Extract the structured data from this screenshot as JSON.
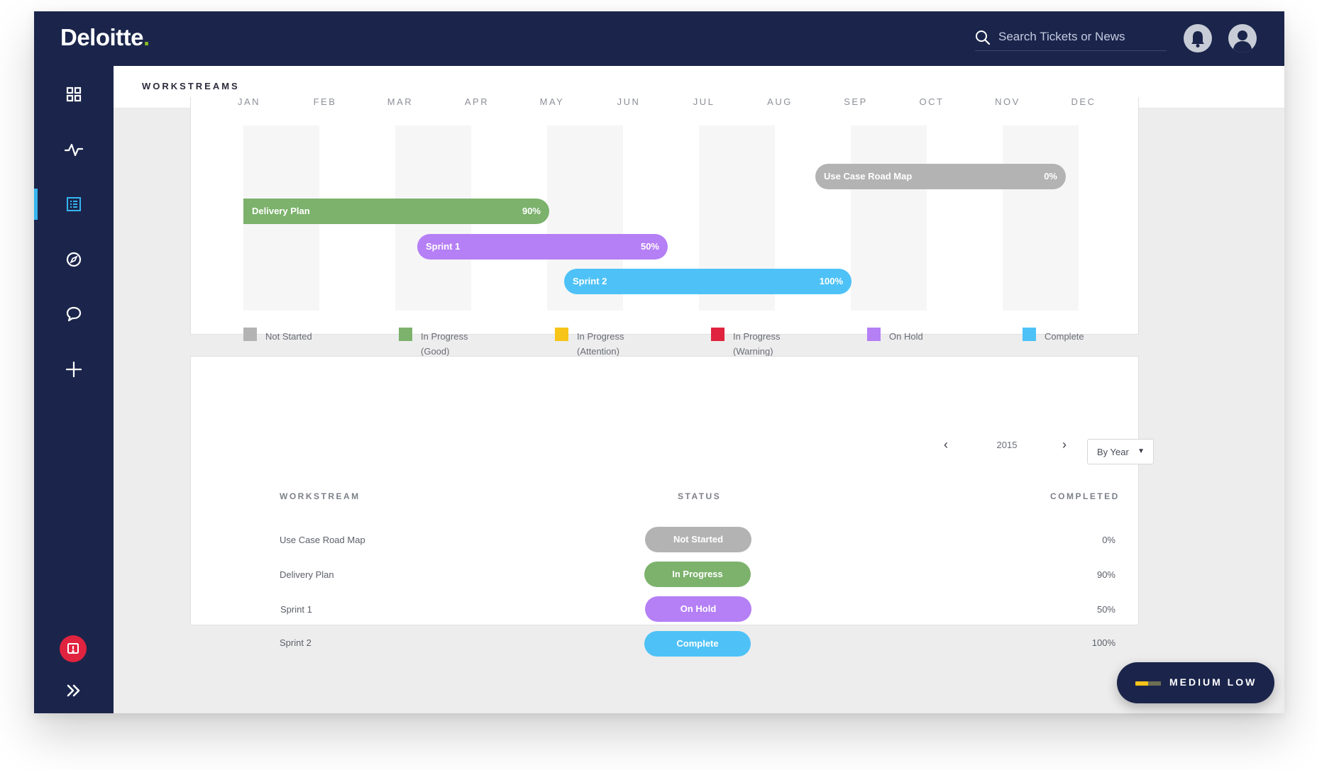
{
  "app": {
    "logo_text": "Deloitte",
    "logo_dot": "."
  },
  "search": {
    "placeholder": "Search Tickets or News"
  },
  "header": {
    "title": "WORKSTREAMS"
  },
  "sidebar": {
    "items": [
      {
        "icon": "grid-icon",
        "active": false
      },
      {
        "icon": "activity-icon",
        "active": false
      },
      {
        "icon": "list-icon",
        "active": true
      },
      {
        "icon": "compass-icon",
        "active": false
      },
      {
        "icon": "chat-icon",
        "active": false
      },
      {
        "icon": "plus-icon",
        "active": false
      }
    ],
    "bottom": [
      "alert-icon",
      "expand-icon"
    ]
  },
  "timeline": {
    "months": [
      "JAN",
      "FEB",
      "MAR",
      "APR",
      "MAY",
      "JUN",
      "JUL",
      "AUG",
      "SEP",
      "OCT",
      "NOV",
      "DEC"
    ],
    "bars": [
      {
        "label": "Use Case Road Map",
        "pct": "0%",
        "color": "#b3b3b3"
      },
      {
        "label": "Delivery Plan",
        "pct": "90%",
        "color": "#7cb26c"
      },
      {
        "label": "Sprint 1",
        "pct": "50%",
        "color": "#b57ff5"
      },
      {
        "label": "Sprint 2",
        "pct": "100%",
        "color": "#4ec2f7"
      }
    ]
  },
  "legend": [
    {
      "line1": "Not Started",
      "line2": "",
      "color": "#b3b3b3"
    },
    {
      "line1": "In Progress",
      "line2": "(Good)",
      "color": "#7cb26c"
    },
    {
      "line1": "In Progress",
      "line2": "(Attention)",
      "color": "#f7c419"
    },
    {
      "line1": "In Progress",
      "line2": "(Warning)",
      "color": "#e0233f"
    },
    {
      "line1": "On Hold",
      "line2": "",
      "color": "#b57ff5"
    },
    {
      "line1": "Complete",
      "line2": "",
      "color": "#4ec2f7"
    }
  ],
  "table": {
    "pager": {
      "prev": "‹",
      "year": "2015",
      "next": "›"
    },
    "range": {
      "value": "By Year",
      "caret": "▼"
    },
    "headers": {
      "workstream": "WORKSTREAM",
      "status": "STATUS",
      "completed": "COMPLETED"
    },
    "rows": [
      {
        "name": "Use Case Road Map",
        "status": "Not Started",
        "color": "#b3b3b3",
        "completed": "0%"
      },
      {
        "name": "Delivery Plan",
        "status": "In Progress",
        "color": "#7cb26c",
        "completed": "90%"
      },
      {
        "name": "Sprint 1",
        "status": "On Hold",
        "color": "#b57ff5",
        "completed": "50%"
      },
      {
        "name": "Sprint 2",
        "status": "Complete",
        "color": "#4ec2f7",
        "completed": "100%"
      }
    ]
  },
  "priority": {
    "label": "MEDIUM LOW",
    "color": "#f7c419"
  }
}
